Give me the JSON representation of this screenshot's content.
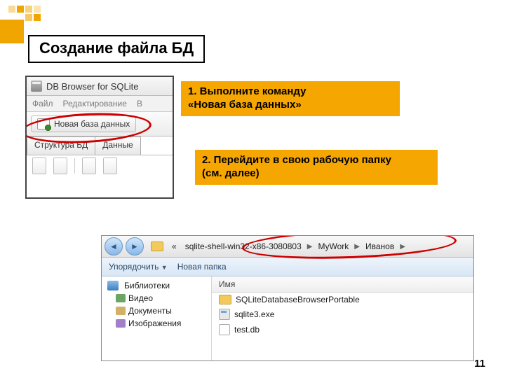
{
  "slide": {
    "title": "Создание файла БД",
    "page_number": "11"
  },
  "annotations": {
    "a1_line1": "1. Выполните команду",
    "a1_line2": "«Новая база данных»",
    "a2_line1": "2. Перейдите в свою рабочую папку",
    "a2_line2": "(см. далее)"
  },
  "shot1": {
    "window_title": "DB Browser for SQLite",
    "menu": {
      "file": "Файл",
      "edit": "Редактирование",
      "view_initial": "В"
    },
    "new_db_button": "Новая база данных",
    "tabs": {
      "structure": "Структура БД",
      "data": "Данные"
    }
  },
  "shot2": {
    "breadcrumb": {
      "prefix": "«",
      "seg1": "sqlite-shell-win32-x86-3080803",
      "seg2": "MyWork",
      "seg3": "Иванов"
    },
    "commands": {
      "organize": "Упорядочить",
      "new_folder": "Новая папка"
    },
    "nav": {
      "libraries": "Библиотеки",
      "video": "Видео",
      "documents": "Документы",
      "images": "Изображения"
    },
    "list": {
      "header_name": "Имя",
      "file1": "SQLiteDatabaseBrowserPortable",
      "file2": "sqlite3.exe",
      "file3": "test.db"
    }
  }
}
